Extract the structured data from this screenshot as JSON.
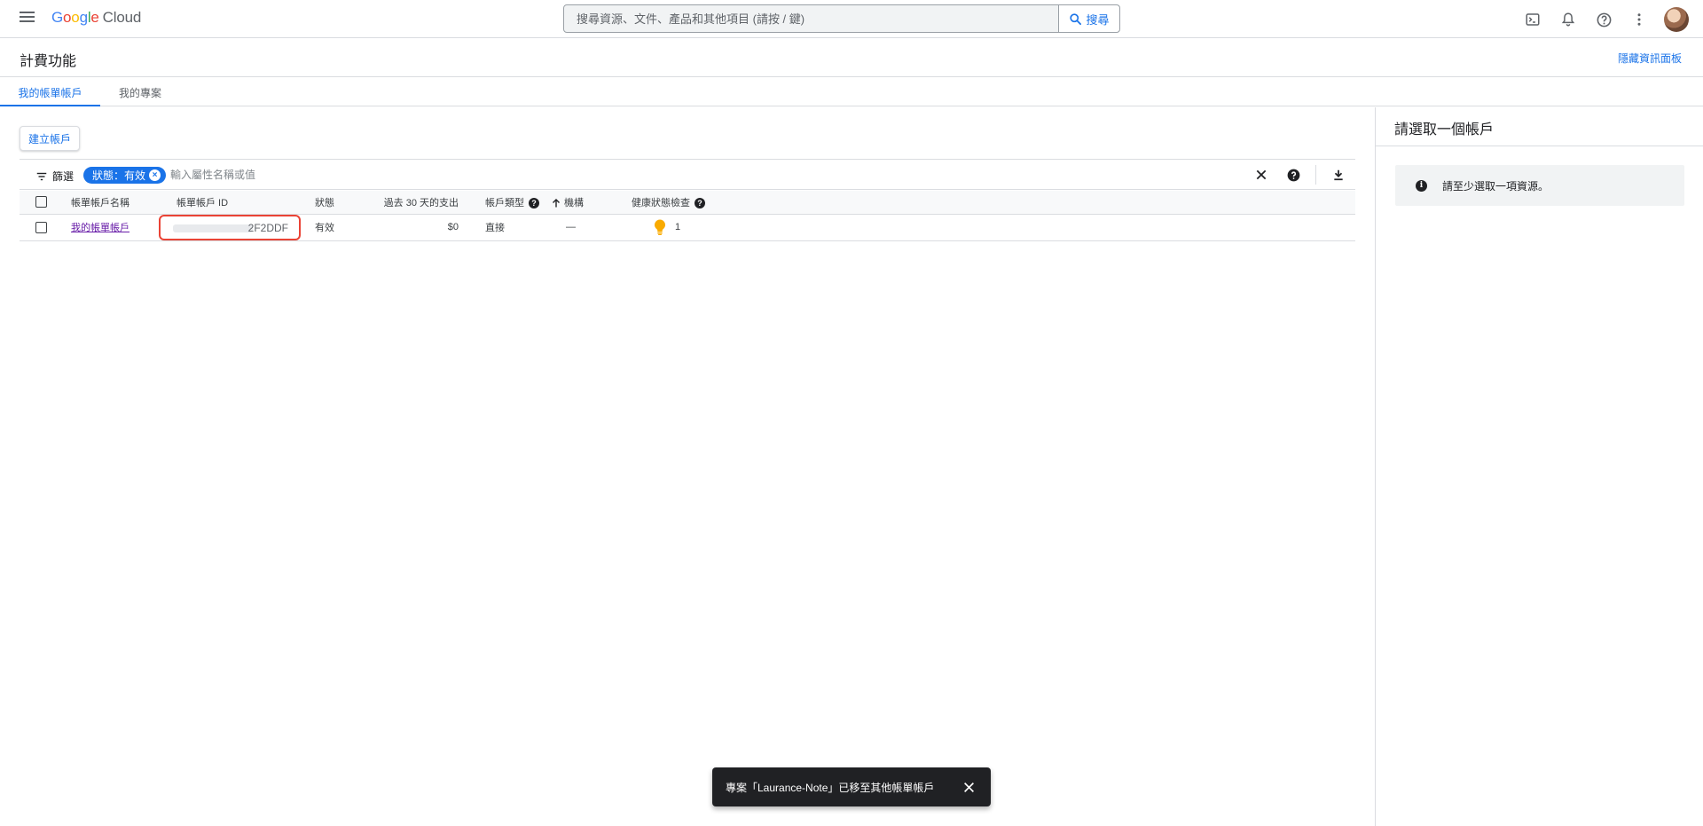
{
  "header": {
    "logo_google": "Google",
    "logo_cloud": "Cloud",
    "search_placeholder": "搜尋資源、文件、產品和其他項目 (請按 / 鍵)",
    "search_button": "搜尋",
    "icons": [
      "cloud-shell-icon",
      "notifications-icon",
      "help-icon",
      "more-vert-icon",
      "avatar"
    ]
  },
  "page": {
    "title": "計費功能",
    "hide_panel": "隱藏資訊面板"
  },
  "tabs": [
    {
      "label": "我的帳單帳戶",
      "active": true
    },
    {
      "label": "我的專案",
      "active": false
    }
  ],
  "toolbar": {
    "create_button": "建立帳戶"
  },
  "filter": {
    "label": "篩選",
    "chip": "狀態：有效",
    "placeholder": "輸入屬性名稱或值"
  },
  "table": {
    "columns": {
      "name": "帳單帳戶名稱",
      "id": "帳單帳戶 ID",
      "status": "狀態",
      "spend": "過去 30 天的支出",
      "type": "帳戶類型",
      "org": "機構",
      "health": "健康狀態檢查"
    },
    "rows": [
      {
        "name": "我的帳單帳戶",
        "id_visible": "2F2DDF",
        "status": "有效",
        "spend": "$0",
        "type": "直接",
        "org": "—",
        "health": "1"
      }
    ]
  },
  "right_panel": {
    "title": "請選取一個帳戶",
    "info": "請至少選取一項資源。"
  },
  "snackbar": {
    "message": "專案「Laurance-Note」已移至其他帳單帳戶"
  },
  "colors": {
    "accent": "#1a73e8",
    "link_visited": "#681da8",
    "highlight_box": "#ea4335",
    "health_bulb": "#f9ab00"
  }
}
